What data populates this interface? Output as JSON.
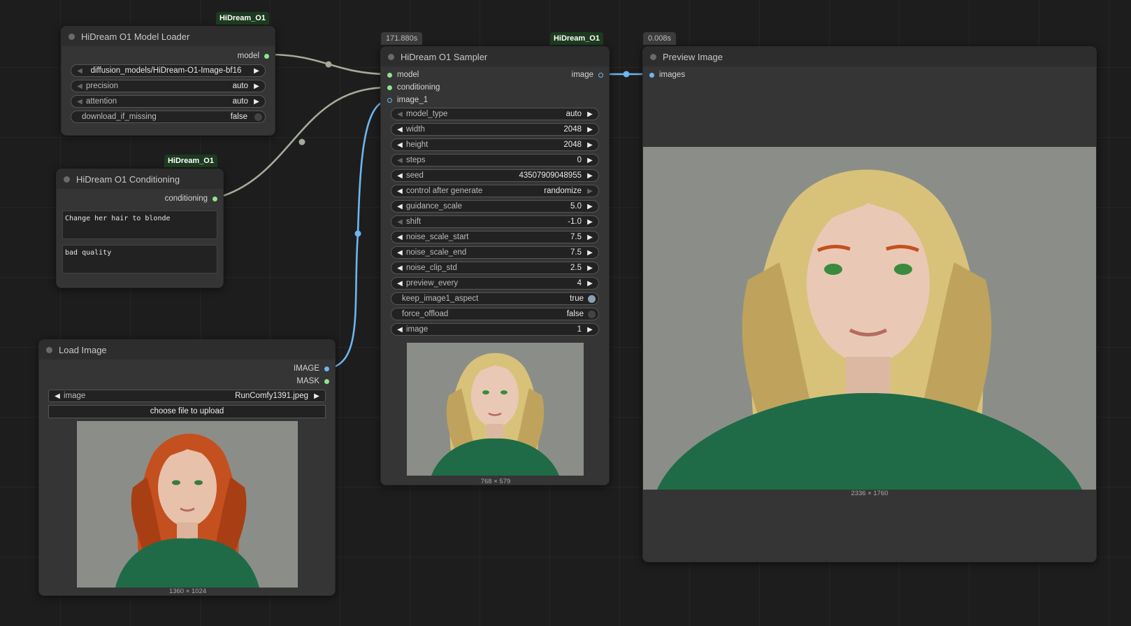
{
  "model_loader": {
    "title": "HiDream O1 Model Loader",
    "badge": "HiDream_O1",
    "output_model": "model",
    "widgets": {
      "model_path": "diffusion_models/HiDream-O1-Image-bf16",
      "precision_label": "precision",
      "precision_value": "auto",
      "attention_label": "attention",
      "attention_value": "auto",
      "download_label": "download_if_missing",
      "download_value": "false"
    }
  },
  "conditioning": {
    "title": "HiDream O1 Conditioning",
    "badge": "HiDream_O1",
    "output_conditioning": "conditioning",
    "positive_prompt": "Change her hair to blonde",
    "negative_prompt": "bad quality"
  },
  "load_image": {
    "title": "Load Image",
    "output_image": "IMAGE",
    "output_mask": "MASK",
    "image_label": "image",
    "image_value": "RunComfy1391.jpeg",
    "upload_label": "choose file to upload",
    "dims": "1360 × 1024"
  },
  "sampler": {
    "title": "HiDream O1 Sampler",
    "badge": "HiDream_O1",
    "time": "171.880s",
    "inputs": {
      "model": "model",
      "conditioning": "conditioning",
      "image_1": "image_1"
    },
    "output_image": "image",
    "widgets": {
      "model_type": "auto",
      "width": "2048",
      "height": "2048",
      "steps": "0",
      "seed": "43507909048955",
      "control_after_generate": "randomize",
      "guidance_scale": "5.0",
      "shift": "-1.0",
      "noise_scale_start": "7.5",
      "noise_scale_end": "7.5",
      "noise_clip_std": "2.5",
      "preview_every": "4",
      "keep_image1_aspect": "true",
      "force_offload": "false",
      "image": "1"
    },
    "labels": {
      "model_type": "model_type",
      "width": "width",
      "height": "height",
      "steps": "steps",
      "seed": "seed",
      "control_after_generate": "control after generate",
      "guidance_scale": "guidance_scale",
      "shift": "shift",
      "noise_scale_start": "noise_scale_start",
      "noise_scale_end": "noise_scale_end",
      "noise_clip_std": "noise_clip_std",
      "preview_every": "preview_every",
      "keep_image1_aspect": "keep_image1_aspect",
      "force_offload": "force_offload",
      "image": "image"
    },
    "dims": "768 × 579"
  },
  "preview": {
    "title": "Preview Image",
    "time": "0.008s",
    "input_images": "images",
    "dims": "2336 × 1760"
  },
  "colors": {
    "model_wire": "#a3ab9a",
    "image_wire": "#6fb5ef",
    "hair_red": "#c4501f",
    "hair_blonde": "#d8c27a",
    "shirt_green": "#1f6b47",
    "photo_bg": "#8b8e88"
  }
}
